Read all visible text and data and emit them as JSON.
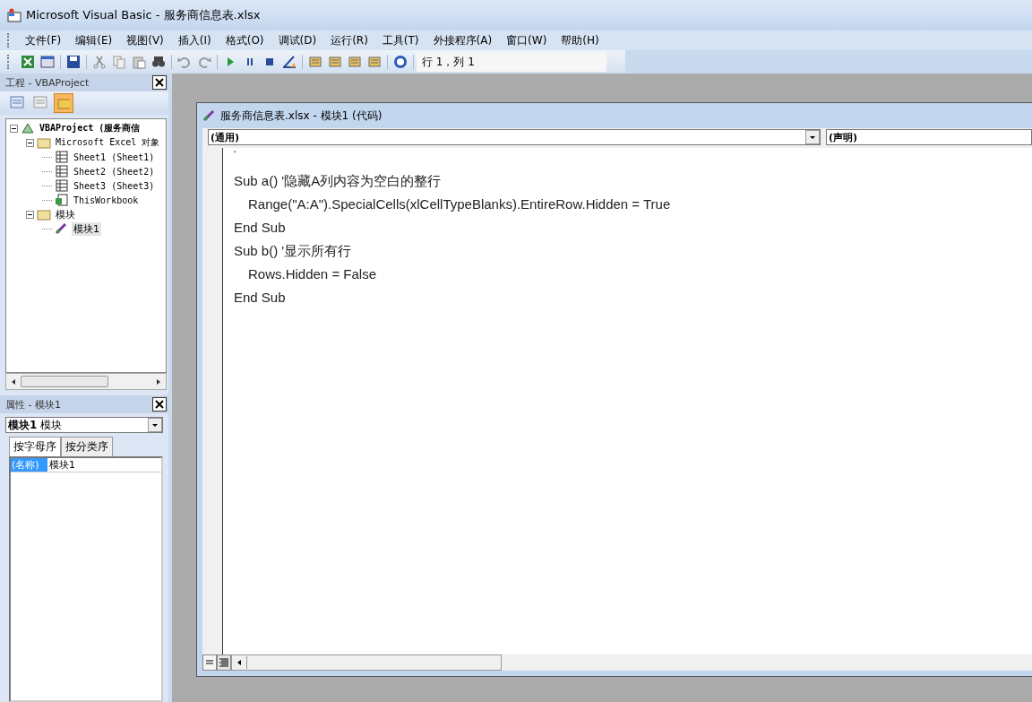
{
  "window": {
    "title": "Microsoft Visual Basic - 服务商信息表.xlsx"
  },
  "menu": [
    "文件(F)",
    "编辑(E)",
    "视图(V)",
    "插入(I)",
    "格式(O)",
    "调试(D)",
    "运行(R)",
    "工具(T)",
    "外接程序(A)",
    "窗口(W)",
    "帮助(H)"
  ],
  "toolbar": {
    "position": "行 1，列 1"
  },
  "project_panel": {
    "title": "工程 - VBAProject",
    "tree": [
      {
        "label": "VBAProject (服务商信",
        "kind": "project",
        "expanded": true,
        "selected": false,
        "children": [
          {
            "label": "Microsoft Excel 对象",
            "kind": "folder",
            "expanded": true,
            "selected": false,
            "children": [
              {
                "label": "Sheet1 (Sheet1)",
                "kind": "sheet",
                "selected": false
              },
              {
                "label": "Sheet2 (Sheet2)",
                "kind": "sheet",
                "selected": false
              },
              {
                "label": "Sheet3 (Sheet3)",
                "kind": "sheet",
                "selected": false
              },
              {
                "label": "ThisWorkbook",
                "kind": "workbook",
                "selected": false
              }
            ]
          },
          {
            "label": "模块",
            "kind": "folder",
            "expanded": true,
            "selected": false,
            "children": [
              {
                "label": "模块1",
                "kind": "module",
                "selected": true
              }
            ]
          }
        ]
      }
    ]
  },
  "properties_panel": {
    "title": "属性 - 模块1",
    "object_name": "模块1",
    "object_type": "模块",
    "tabs": [
      {
        "label": "按字母序",
        "selected": true
      },
      {
        "label": "按分类序",
        "selected": false
      }
    ],
    "rows": [
      {
        "name": "(名称)",
        "value": "模块1",
        "selected": true
      }
    ]
  },
  "code_window": {
    "title": "服务商信息表.xlsx - 模块1 (代码)",
    "object_dropdown": "(通用)",
    "procedure_dropdown": "(声明)",
    "lines": [
      {
        "text": "'",
        "indent": false
      },
      {
        "text": "Sub a() '隐藏A列内容为空白的整行",
        "indent": false
      },
      {
        "text": "Range(\"A:A\").SpecialCells(xlCellTypeBlanks).EntireRow.Hidden = True",
        "indent": true
      },
      {
        "text": "End Sub",
        "indent": false
      },
      {
        "text": "Sub b() '显示所有行",
        "indent": false
      },
      {
        "text": "Rows.Hidden = False",
        "indent": true
      },
      {
        "text": "End Sub",
        "indent": false
      }
    ]
  }
}
